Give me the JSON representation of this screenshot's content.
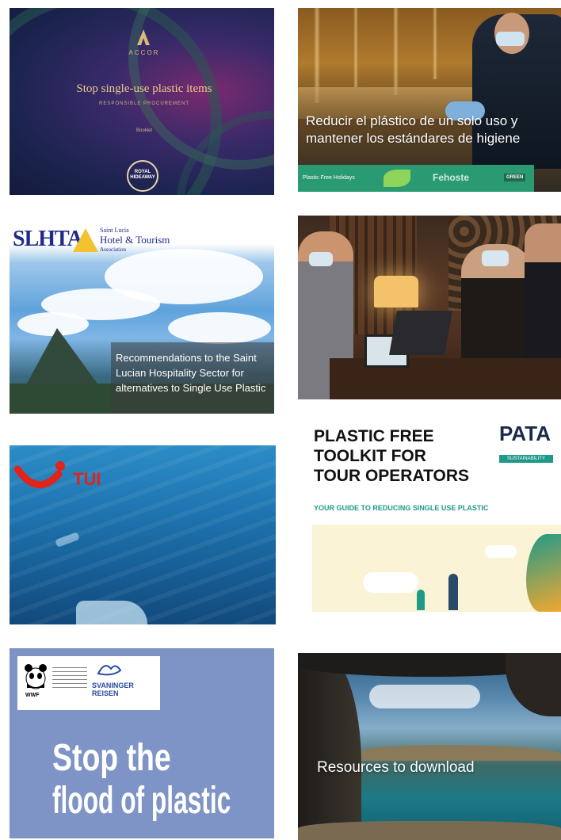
{
  "tiles": {
    "accor": {
      "brand": "ACCOR",
      "title": "Stop single-use plastic items",
      "subtitle": "RESPONSIBLE PROCUREMENT",
      "footer": "Booklet",
      "badge": "ROYAL HIDEAWAY"
    },
    "spanish": {
      "caption": "Reducir el plástico de un solo uso y mantener los estándares de higiene",
      "bar_left": "Plastic Free Holidays",
      "bar_mid": "Fehoste",
      "bar_right": "GREEN"
    },
    "slhta": {
      "logo": "SLHTA",
      "org_line1": "Saint Lucia",
      "org_line2": "Hotel & Tourism",
      "org_line3": "Association",
      "caption": "Recommendations to the Saint Lucian Hospitality Sector for alternatives to Single Use Plastic"
    },
    "hotel": {},
    "tui": {
      "brand": "TUI"
    },
    "pata": {
      "title_line1": "PLASTIC FREE",
      "title_line2": "TOOLKIT FOR",
      "title_line3": "TOUR OPERATORS",
      "logo": "PATA",
      "logo_sub": "SUSTAINABILITY",
      "subtitle": "YOUR GUIDE TO REDUCING SINGLE USE PLASTIC"
    },
    "wwf": {
      "wwf_label": "WWF",
      "partner": "SVANINGER REISEN",
      "title_line1": "Stop the",
      "title_line2": "flood of plastic"
    },
    "resources": {
      "caption": "Resources to download"
    }
  },
  "colors": {
    "accent_green": "#2a9a72",
    "pata_teal": "#1f9a8a",
    "tui_red": "#e2231a",
    "slhta_blue": "#1f2a8a"
  }
}
